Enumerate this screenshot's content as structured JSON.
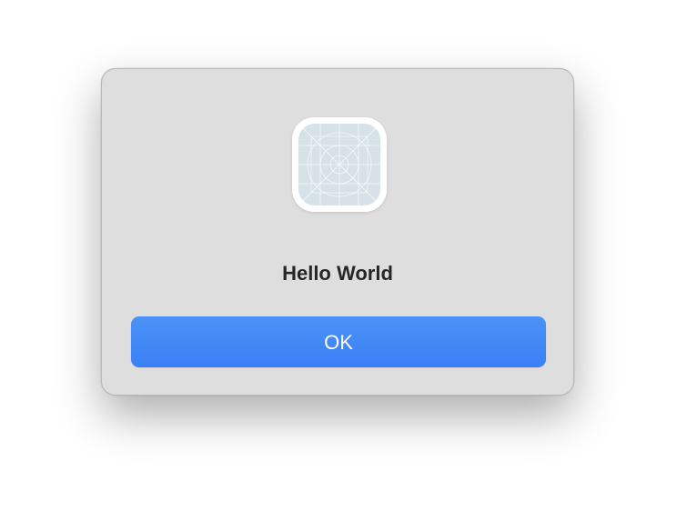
{
  "dialog": {
    "title": "Hello World",
    "ok_label": "OK",
    "icon": "generic-app-icon"
  },
  "colors": {
    "dialog_background": "#dedede",
    "button_accent": "#3a80f6",
    "button_text": "#ffffff",
    "icon_tile": "#d6e2e8",
    "title_text": "#262626"
  }
}
